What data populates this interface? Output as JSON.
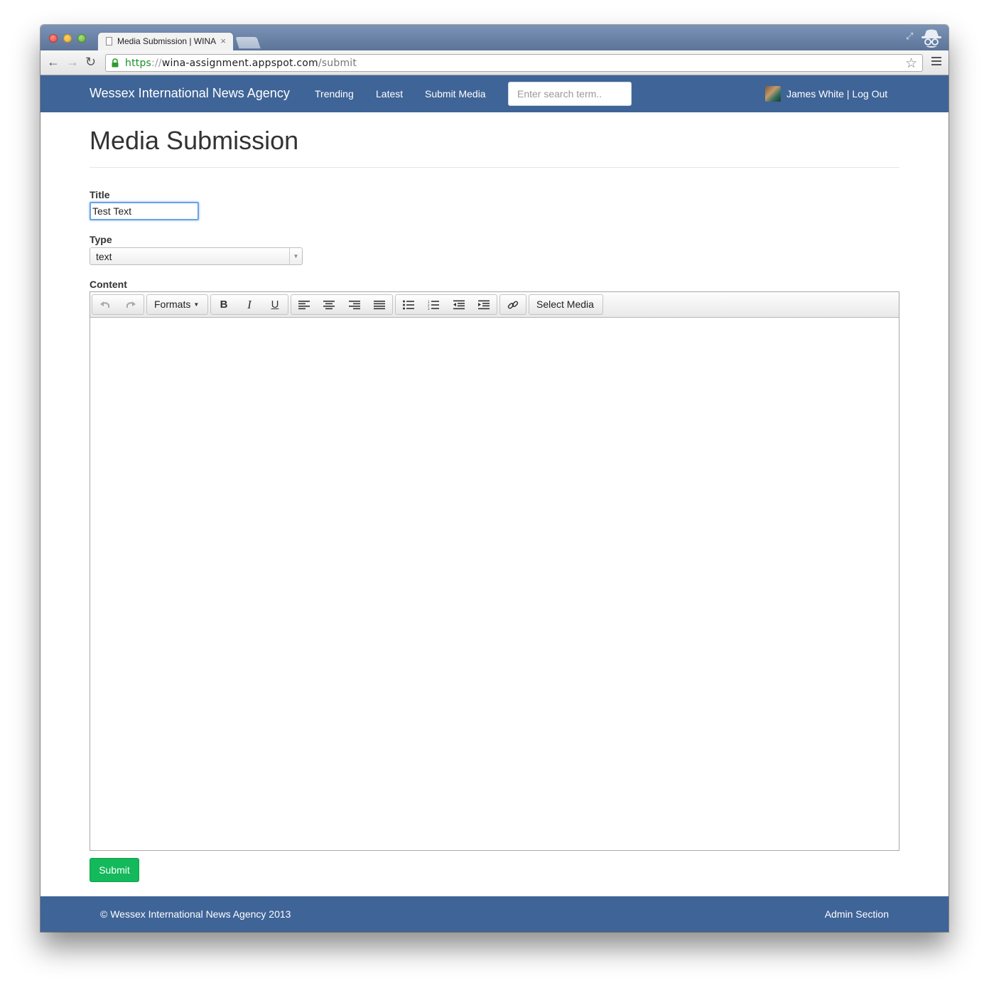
{
  "browser": {
    "tab_title": "Media Submission | WINA",
    "tab_close": "×",
    "url_scheme": "https",
    "url_sep": "://",
    "url_host": "wina-assignment.appspot.com",
    "url_path": "/submit"
  },
  "navbar": {
    "brand": "Wessex International News Agency",
    "links": [
      "Trending",
      "Latest",
      "Submit Media"
    ],
    "search_placeholder": "Enter search term..",
    "user": "James White | Log Out"
  },
  "page": {
    "title": "Media Submission"
  },
  "form": {
    "title_label": "Title",
    "title_value": "Test Text",
    "type_label": "Type",
    "type_value": "text",
    "content_label": "Content",
    "toolbar": {
      "formats_label": "Formats",
      "select_media_label": "Select Media",
      "icons": [
        "undo-icon",
        "redo-icon",
        "bold-icon",
        "italic-icon",
        "underline-icon",
        "align-left-icon",
        "align-center-icon",
        "align-right-icon",
        "align-justify-icon",
        "bullet-list-icon",
        "numbered-list-icon",
        "outdent-icon",
        "indent-icon",
        "link-icon"
      ]
    },
    "submit_label": "Submit"
  },
  "footer": {
    "copyright": "© Wessex International News Agency 2013",
    "admin": "Admin Section"
  },
  "colors": {
    "navbar": "#3f6497",
    "submit": "#13b95a",
    "focus": "#6aa3e6"
  }
}
